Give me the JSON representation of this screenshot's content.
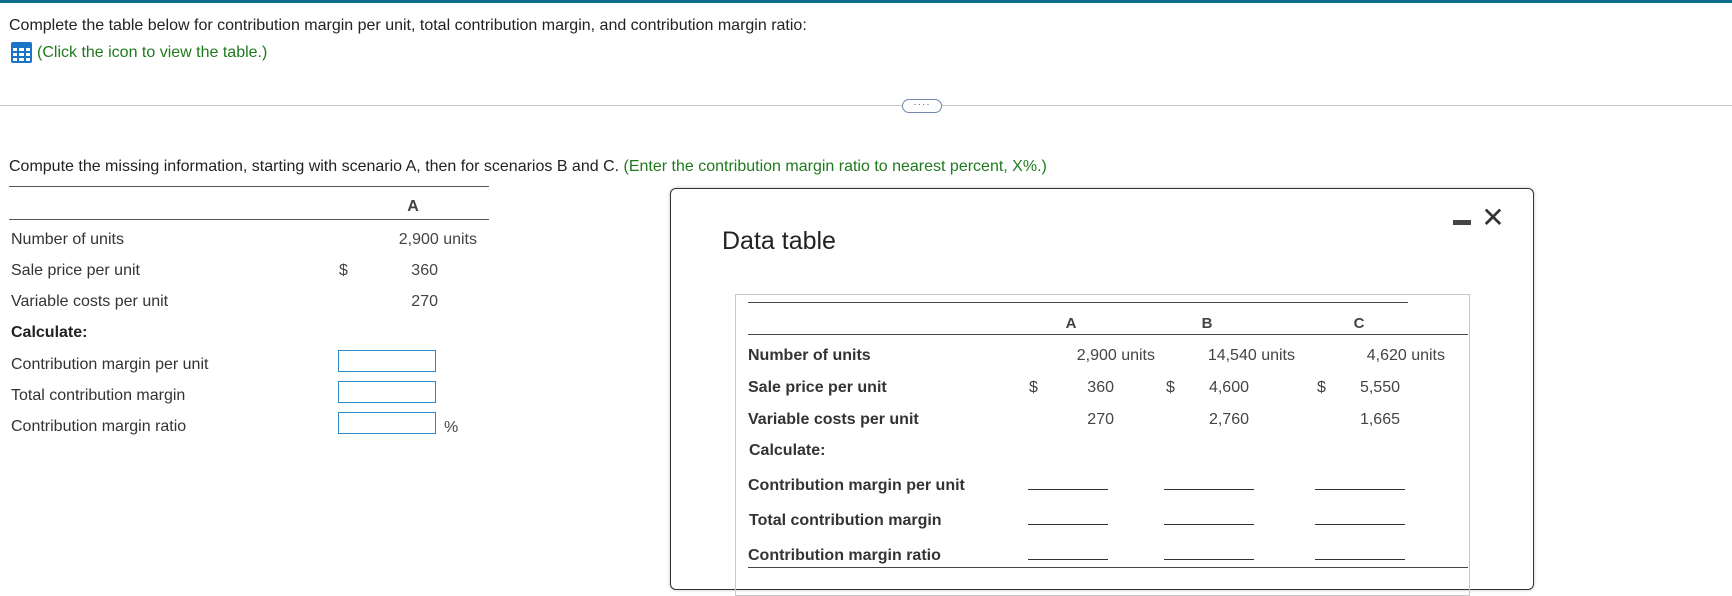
{
  "question": {
    "prompt": "Complete the table below for contribution margin per unit, total contribution margin, and contribution margin ratio:",
    "icon_link": "(Click the icon to view the table.)",
    "icon_name": "table-grid-icon",
    "more_label": "····"
  },
  "instructions": {
    "main": "Compute the missing information, starting with scenario A, then for scenarios B and C.",
    "hint": "(Enter the contribution margin ratio to nearest percent, X%.)"
  },
  "left_table": {
    "column": "A",
    "rows": {
      "units_label": "Number of units",
      "units_value": "2,900 units",
      "price_label": "Sale price per unit",
      "price_dollar": "$",
      "price_value": "360",
      "vc_label": "Variable costs per unit",
      "vc_value": "270",
      "calc_label": "Calculate:",
      "cm_unit_label": "Contribution margin per unit",
      "cm_total_label": "Total contribution margin",
      "cm_ratio_label": "Contribution margin ratio",
      "cm_unit_value": "",
      "cm_total_value": "",
      "cm_ratio_value": "",
      "pct_symbol": "%"
    }
  },
  "data_table": {
    "title": "Data table",
    "columns": [
      "A",
      "B",
      "C"
    ],
    "rows": {
      "units_label": "Number of units",
      "units": [
        "2,900 units",
        "14,540 units",
        "4,620 units"
      ],
      "price_label": "Sale price per unit",
      "dollar": "$",
      "price": [
        "360",
        "4,600",
        "5,550"
      ],
      "vc_label": "Variable costs per unit",
      "vc": [
        "270",
        "2,760",
        "1,665"
      ],
      "calc_label": "Calculate:",
      "cm_unit_label": "Contribution margin per unit",
      "cm_total_label": "Total contribution margin",
      "cm_ratio_label": "Contribution margin ratio"
    }
  },
  "colors": {
    "accent_bar": "#0e6e8f",
    "link_green": "#1f7a1f",
    "input_border": "#2d8ac7",
    "icon_blue": "#1a73c7"
  }
}
